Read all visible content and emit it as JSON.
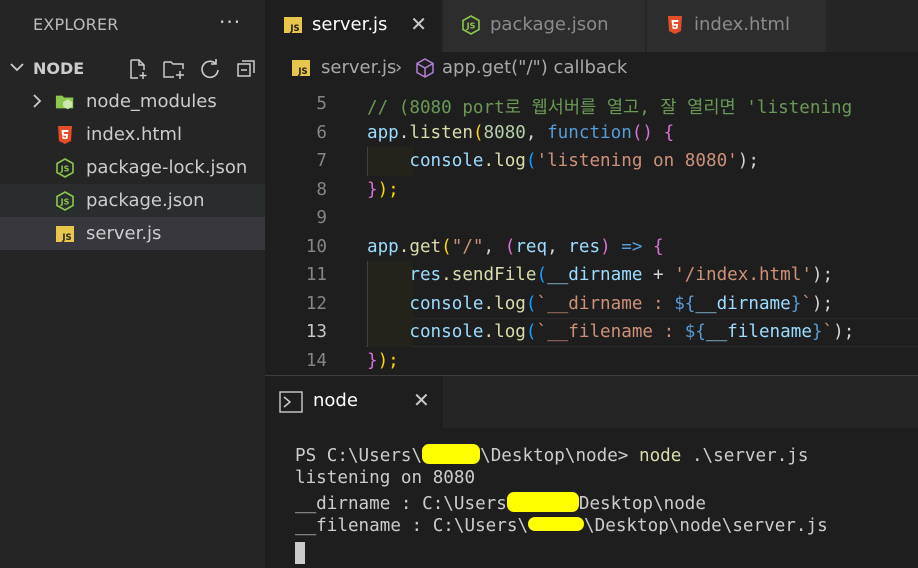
{
  "sidebar": {
    "title": "EXPLORER",
    "more": "···",
    "section": "NODE",
    "files": [
      {
        "label": "node_modules",
        "icon": "folder-node-icon"
      },
      {
        "label": "index.html",
        "icon": "html5-icon"
      },
      {
        "label": "package-lock.json",
        "icon": "nodejs-icon"
      },
      {
        "label": "package.json",
        "icon": "nodejs-icon"
      },
      {
        "label": "server.js",
        "icon": "js-icon"
      }
    ]
  },
  "tabs": [
    {
      "label": "server.js",
      "icon": "js-icon",
      "close": "✕"
    },
    {
      "label": "package.json",
      "icon": "nodejs-icon"
    },
    {
      "label": "index.html",
      "icon": "html5-icon"
    }
  ],
  "breadcrumb": {
    "file": "server.js",
    "sep": "›",
    "symbol": "app.get(\"/\") callback"
  },
  "code": {
    "line_numbers": [
      "5",
      "6",
      "7",
      "8",
      "9",
      "10",
      "11",
      "12",
      "13",
      "14"
    ],
    "comment": "// (8080 port로 웹서버를 열고, 잘 열리면 'listening",
    "l6": {
      "obj": "app",
      "dot": ".",
      "fn": "listen",
      "open": "(",
      "num": "8080",
      "comma": ", ",
      "kw": "function",
      "paren": "()",
      "brace": "{"
    },
    "l7": {
      "obj": "console",
      "fn": ".log",
      "open": "(",
      "str": "'listening on 8080'",
      "close": ");"
    },
    "l8": {
      "brace": "}",
      "close": ");"
    },
    "l10": {
      "obj": "app",
      "fn": ".get",
      "open": "(",
      "str": "\"/\"",
      "comma": ", ",
      "params_open": "(",
      "p1": "req",
      "psep": ", ",
      "p2": "res",
      "params_close": ")",
      "arrow": " => ",
      "brace": "{"
    },
    "l11": {
      "obj": "res",
      "fn": ".sendFile",
      "open": "(",
      "arg": "__dirname",
      "plus": " + ",
      "str": "'/index.html'",
      "close": ");"
    },
    "l12": {
      "obj": "console",
      "fn": ".log",
      "open": "(",
      "tpl1": "`__dirname : ",
      "tplopen": "${",
      "var": "__dirname",
      "tplclose": "}",
      "tplend": "`",
      "close": ");"
    },
    "l13": {
      "obj": "console",
      "fn": ".log",
      "open": "(",
      "tpl1": "`__filename : ",
      "tplopen": "${",
      "var": "__filename",
      "tplclose": "}",
      "tplend": "`",
      "close": ");"
    },
    "l14": {
      "brace": "}",
      "close": ");"
    }
  },
  "terminal": {
    "tab_label": "node",
    "close": "✕",
    "l1_a": "PS C:\\Users\\",
    "l1_b": "\\Desktop\\node> ",
    "l1_cmd": "node",
    "l1_arg": " .\\server.js",
    "l2": "listening on 8080",
    "l3_a": "__dirname : C:\\Users",
    "l3_b": "Desktop\\node",
    "l4_a": "__filename : C:\\Users\\",
    "l4_b": "\\Desktop\\node\\server.js"
  },
  "colors": {
    "redaction": "#ffff00",
    "js": "#e8c64b",
    "html": "#e44d26",
    "node": "#8cc84b"
  }
}
